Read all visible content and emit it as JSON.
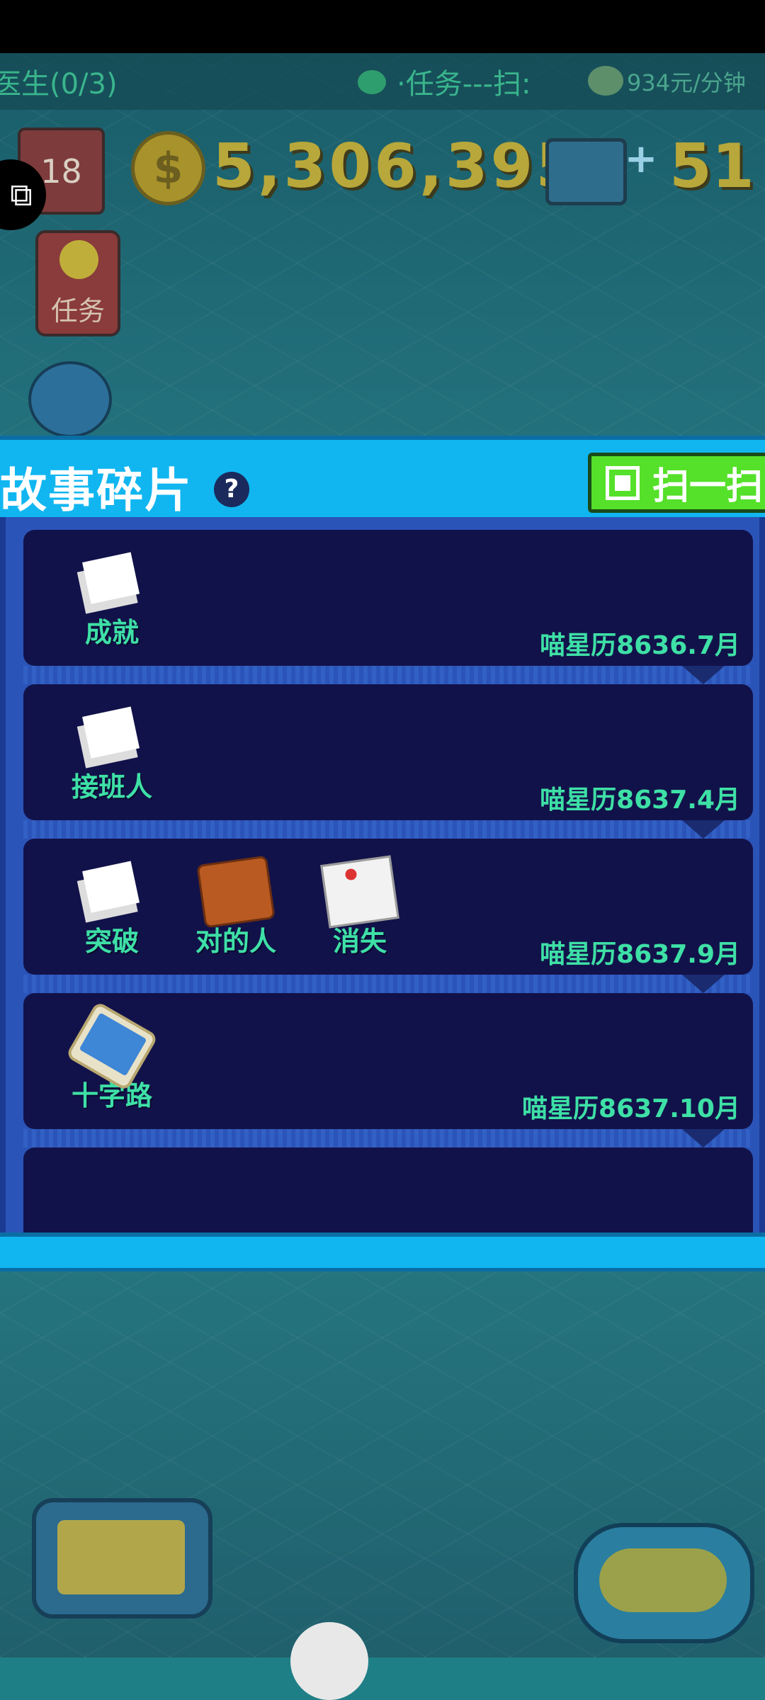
{
  "ticker": {
    "left_text": "医生(0/3)",
    "task_text": "·任务---扫:",
    "rate_text": "934元/分钟"
  },
  "hud": {
    "calendar_day": "18",
    "coin_symbol": "$",
    "money": "5,306,395",
    "stamina": "51",
    "task_button_label": "任务"
  },
  "panel": {
    "title": "故事碎片",
    "help_symbol": "?",
    "scan_button_label": "扫一扫"
  },
  "stories": [
    {
      "date": "喵星历8636.7月",
      "items": [
        {
          "label": "成就",
          "icon": "newspaper-icon"
        }
      ]
    },
    {
      "date": "喵星历8637.4月",
      "items": [
        {
          "label": "接班人",
          "icon": "newspaper-icon"
        }
      ]
    },
    {
      "date": "喵星历8637.9月",
      "items": [
        {
          "label": "突破",
          "icon": "newspaper-icon"
        },
        {
          "label": "对的人",
          "icon": "wallet-icon"
        },
        {
          "label": "消失",
          "icon": "medical-record-icon"
        }
      ]
    },
    {
      "date": "喵星历8637.10月",
      "items": [
        {
          "label": "十字路",
          "icon": "phone-icon"
        }
      ]
    }
  ],
  "colors": {
    "panel_header": "#11b6f0",
    "panel_body": "#2b54b8",
    "card": "#12124a",
    "label_text": "#3ee0a6",
    "scan_button": "#55e02a"
  }
}
